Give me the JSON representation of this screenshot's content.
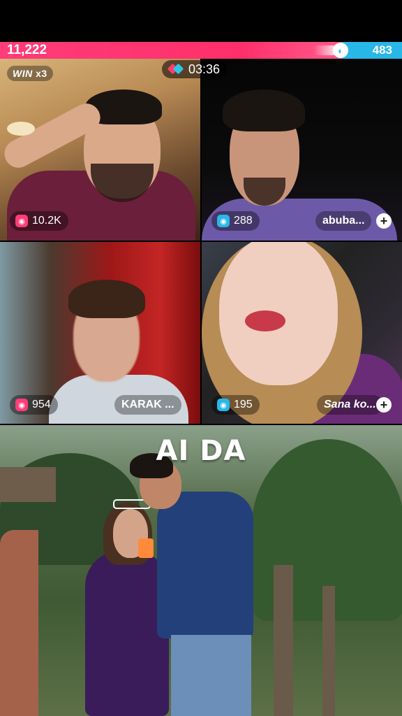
{
  "battle": {
    "left_score": "11,222",
    "right_score": "483",
    "left_color": "#ff2f6b",
    "right_color": "#29b7e8",
    "left_fraction": 0.85
  },
  "win_badge": {
    "label": "WIN",
    "multiplier": "x3"
  },
  "timer": {
    "time": "03:36",
    "icon": "battle-icon"
  },
  "tiles": [
    {
      "score": "10.2K",
      "team": "pink",
      "name": ""
    },
    {
      "score": "288",
      "team": "blue",
      "name": "abuba...",
      "has_follow": true
    },
    {
      "score": "954",
      "team": "pink",
      "name": "KARAK ..."
    },
    {
      "score": "195",
      "team": "blue",
      "name": "Sana ko...",
      "has_follow": true
    }
  ],
  "bottom_caption": "AI DA",
  "follow_label": "+"
}
